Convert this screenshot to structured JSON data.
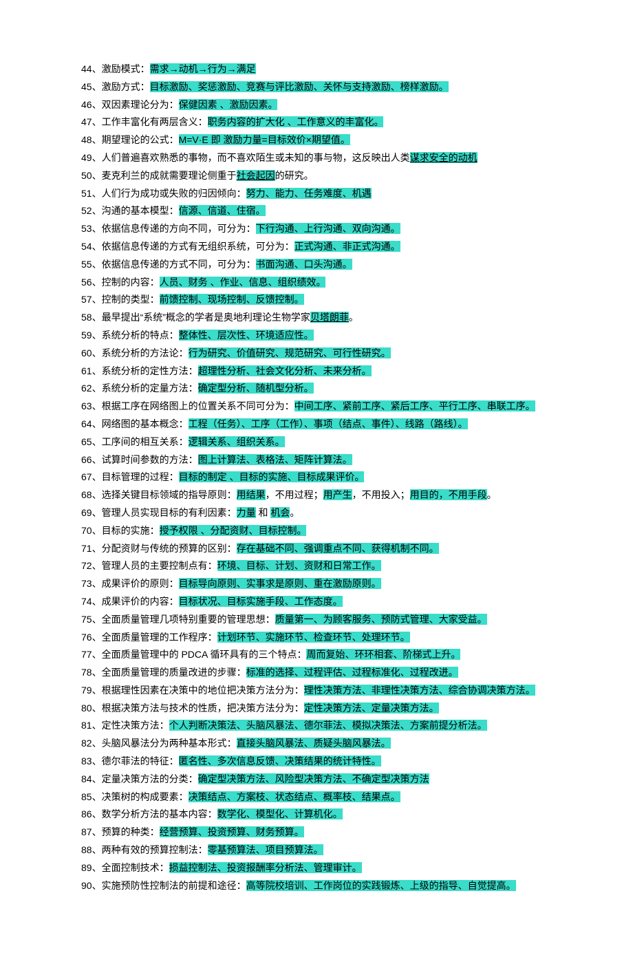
{
  "lines": [
    {
      "num": "44、",
      "parts": [
        {
          "t": "plain",
          "v": "激励模式："
        },
        {
          "t": "hl",
          "v": "需求→动机→行为→满足"
        }
      ]
    },
    {
      "num": "45、",
      "parts": [
        {
          "t": "plain",
          "v": "激励方式："
        },
        {
          "t": "hl",
          "v": "目标激励、奖惩激励、竞赛与评比激励、关怀与支持激励、榜样激励。"
        }
      ]
    },
    {
      "num": "46、",
      "parts": [
        {
          "t": "plain",
          "v": "双因素理论分为："
        },
        {
          "t": "hl",
          "v": "保健因素 、激励因素。"
        }
      ]
    },
    {
      "num": "47、",
      "parts": [
        {
          "t": "plain",
          "v": "工作丰富化有两层含义："
        },
        {
          "t": "hl",
          "v": "职务内容的扩大化 、工作意义的丰富化。"
        }
      ]
    },
    {
      "num": "48、",
      "parts": [
        {
          "t": "plain",
          "v": "期望理论的公式："
        },
        {
          "t": "hl",
          "v": "M=V·E 即 激励力量=目标效价×期望值。"
        }
      ]
    },
    {
      "num": "49、",
      "parts": [
        {
          "t": "plain",
          "v": "人们普遍喜欢熟悉的事物，而不喜欢陌生或未知的事与物，这反映出人类"
        },
        {
          "t": "hlul",
          "v": "谋求安全的动机"
        }
      ]
    },
    {
      "num": "50、",
      "parts": [
        {
          "t": "plain",
          "v": "麦克利兰的成就需要理论侧重于"
        },
        {
          "t": "hlul",
          "v": "社会起因"
        },
        {
          "t": "plain",
          "v": "的研究。"
        }
      ]
    },
    {
      "num": "51、",
      "parts": [
        {
          "t": "plain",
          "v": "人们行为成功或失败的归因倾向："
        },
        {
          "t": "hl",
          "v": "努力、能力、任务难度、机遇"
        }
      ]
    },
    {
      "num": "52、",
      "parts": [
        {
          "t": "plain",
          "v": "沟通的基本模型："
        },
        {
          "t": "hl",
          "v": "信源、信道、住宿。"
        }
      ]
    },
    {
      "num": "53、",
      "parts": [
        {
          "t": "plain",
          "v": "依据信息传递的方向不同，可分为："
        },
        {
          "t": "hl",
          "v": "下行沟通、上行沟通、双向沟通。"
        }
      ]
    },
    {
      "num": "54、",
      "parts": [
        {
          "t": "plain",
          "v": "依据信息传递的方式有无组织系统，可分为："
        },
        {
          "t": "hl",
          "v": "正式沟通、非正式沟通。"
        }
      ]
    },
    {
      "num": "55、",
      "parts": [
        {
          "t": "plain",
          "v": "依据信息传递的方式不同，可分为："
        },
        {
          "t": "hl",
          "v": "书面沟通、口头沟通。"
        }
      ]
    },
    {
      "num": "56、",
      "parts": [
        {
          "t": "plain",
          "v": "控制的内容："
        },
        {
          "t": "hl",
          "v": "人员、财务 、作业、信息、组织绩效。"
        }
      ]
    },
    {
      "num": "57、",
      "parts": [
        {
          "t": "plain",
          "v": "控制的类型："
        },
        {
          "t": "hl",
          "v": "前馈控制、现场控制、反馈控制。"
        }
      ]
    },
    {
      "num": "58、",
      "parts": [
        {
          "t": "plain",
          "v": "最早提出“系统”概念的学者是奥地利理论生物学家"
        },
        {
          "t": "hlul",
          "v": "贝塔朗菲"
        },
        {
          "t": "plain",
          "v": "。"
        }
      ]
    },
    {
      "num": "59、",
      "parts": [
        {
          "t": "plain",
          "v": "系统分析的特点："
        },
        {
          "t": "hl",
          "v": "整体性、层次性、环境适应性。"
        }
      ]
    },
    {
      "num": "60、",
      "parts": [
        {
          "t": "plain",
          "v": "系统分析的方法论："
        },
        {
          "t": "hl",
          "v": "行为研究、价值研究、规范研究、可行性研究。"
        }
      ]
    },
    {
      "num": "61、",
      "parts": [
        {
          "t": "plain",
          "v": "系统分析的定性方法："
        },
        {
          "t": "hl",
          "v": "超理性分析、社会文化分析、未来分析。"
        }
      ]
    },
    {
      "num": "62、",
      "parts": [
        {
          "t": "plain",
          "v": "系统分析的定量方法："
        },
        {
          "t": "hl",
          "v": "确定型分析、随机型分析。"
        }
      ]
    },
    {
      "num": "63、",
      "parts": [
        {
          "t": "plain",
          "v": "根据工序在网络图上的位置关系不同可分为："
        },
        {
          "t": "hl",
          "v": "中间工序、紧前工序、紧后工序、平行工序、串联工序。"
        }
      ]
    },
    {
      "num": "64、",
      "parts": [
        {
          "t": "plain",
          "v": "网络图的基本概念："
        },
        {
          "t": "hl",
          "v": "工程（任务）、工序（工作）、事项（结点、事件）、线路（路线）。"
        }
      ]
    },
    {
      "num": "65、",
      "parts": [
        {
          "t": "plain",
          "v": "工序间的相互关系："
        },
        {
          "t": "hl",
          "v": "逻辑关系、组织关系。"
        }
      ]
    },
    {
      "num": "66、",
      "parts": [
        {
          "t": "plain",
          "v": "试算时间参数的方法："
        },
        {
          "t": "hl",
          "v": "图上计算法、表格法、矩阵计算法。"
        }
      ]
    },
    {
      "num": "67、",
      "parts": [
        {
          "t": "plain",
          "v": "目标管理的过程："
        },
        {
          "t": "hl",
          "v": "目标的制定 、目标的实施、目标成果评价。"
        }
      ]
    },
    {
      "num": "68、",
      "parts": [
        {
          "t": "plain",
          "v": "选择关键目标领域的指导原则："
        },
        {
          "t": "hl",
          "v": "用结果"
        },
        {
          "t": "plain",
          "v": "，不用过程；"
        },
        {
          "t": "hl",
          "v": "用产生"
        },
        {
          "t": "plain",
          "v": "，不用投入；"
        },
        {
          "t": "hl",
          "v": "用目的，不用手段"
        },
        {
          "t": "plain",
          "v": "。"
        }
      ]
    },
    {
      "num": "69、",
      "parts": [
        {
          "t": "plain",
          "v": "管理人员实现目标的有利因素："
        },
        {
          "t": "hl",
          "v": "力量"
        },
        {
          "t": "plain",
          "v": " 和 "
        },
        {
          "t": "hl",
          "v": "机会"
        },
        {
          "t": "plain",
          "v": "。"
        }
      ]
    },
    {
      "num": "70、",
      "parts": [
        {
          "t": "plain",
          "v": "目标的实施："
        },
        {
          "t": "hl",
          "v": "授予权限 、分配资财、目标控制。"
        }
      ]
    },
    {
      "num": "71、",
      "parts": [
        {
          "t": "plain",
          "v": "分配资财与传统的预算的区别："
        },
        {
          "t": "hl",
          "v": "存在基础不同、强调重点不同、获得机制不同。"
        }
      ]
    },
    {
      "num": "72、",
      "parts": [
        {
          "t": "plain",
          "v": "管理人员的主要控制点有："
        },
        {
          "t": "hl",
          "v": "环境、目标、计划、资财和日常工作。"
        }
      ]
    },
    {
      "num": "73、",
      "parts": [
        {
          "t": "plain",
          "v": "成果评价的原则："
        },
        {
          "t": "hl",
          "v": "目标导向原则、实事求是原则、重在激励原则。"
        }
      ]
    },
    {
      "num": "74、",
      "parts": [
        {
          "t": "plain",
          "v": "成果评价的内容："
        },
        {
          "t": "hl",
          "v": "目标状况、目标实施手段、工作态度。"
        }
      ]
    },
    {
      "num": "75、",
      "parts": [
        {
          "t": "plain",
          "v": "全面质量管理几项特别重要的管理思想："
        },
        {
          "t": "hl",
          "v": "质量第一、为顾客服务、预防式管理、大家受益。"
        }
      ]
    },
    {
      "num": "76、",
      "parts": [
        {
          "t": "plain",
          "v": "全面质量管理的工作程序："
        },
        {
          "t": "hl",
          "v": "计划环节、实施环节、检查环节、处理环节。"
        }
      ]
    },
    {
      "num": "77、",
      "parts": [
        {
          "t": "plain",
          "v": "全面质量管理中的 PDCA 循环具有的三个特点："
        },
        {
          "t": "hl",
          "v": "周而复始、环环相套、阶梯式上升。"
        }
      ]
    },
    {
      "num": "78、",
      "parts": [
        {
          "t": "plain",
          "v": "全面质量管理的质量改进的步骤："
        },
        {
          "t": "hl",
          "v": "标准的选择、过程评估、过程标准化、过程改进。"
        }
      ]
    },
    {
      "num": "79、",
      "parts": [
        {
          "t": "plain",
          "v": "根据理性因素在决策中的地位把决策方法分为："
        },
        {
          "t": "hl",
          "v": "理性决策方法、非理性决策方法、综合协调决策方法。"
        }
      ]
    },
    {
      "num": "80、",
      "parts": [
        {
          "t": "plain",
          "v": "根据决策方法与技术的性质，把决策方法分为："
        },
        {
          "t": "hl",
          "v": "定性决策方法、定量决策方法。"
        }
      ]
    },
    {
      "num": "81、",
      "parts": [
        {
          "t": "plain",
          "v": "定性决策方法："
        },
        {
          "t": "hl",
          "v": "个人判断决策法、头脑风暴法、德尔菲法、模拟决策法、方案前提分析法。"
        }
      ]
    },
    {
      "num": "82、",
      "parts": [
        {
          "t": "plain",
          "v": "头脑风暴法分为两种基本形式："
        },
        {
          "t": "hl",
          "v": "直接头脑风暴法、质疑头脑风暴法。"
        }
      ]
    },
    {
      "num": "83、",
      "parts": [
        {
          "t": "plain",
          "v": "德尔菲法的特征："
        },
        {
          "t": "hl",
          "v": "匿名性、多次信息反馈、决策结果的统计特性。"
        }
      ]
    },
    {
      "num": "84、",
      "parts": [
        {
          "t": "plain",
          "v": "定量决策方法的分类："
        },
        {
          "t": "hl",
          "v": "确定型决策方法、风险型决策方法、不确定型决策方法"
        }
      ]
    },
    {
      "num": "85、",
      "parts": [
        {
          "t": "plain",
          "v": "决策树的构成要素："
        },
        {
          "t": "hl",
          "v": "决策结点、方案枝、状态结点、概率枝、结果点。"
        }
      ]
    },
    {
      "num": "86、",
      "parts": [
        {
          "t": "plain",
          "v": "数学分析方法的基本内容："
        },
        {
          "t": "hl",
          "v": "数学化、模型化、计算机化。"
        }
      ]
    },
    {
      "num": "87、",
      "parts": [
        {
          "t": "plain",
          "v": "预算的种类："
        },
        {
          "t": "hl",
          "v": "经营预算、投资预算、财务预算。"
        }
      ]
    },
    {
      "num": "88、",
      "parts": [
        {
          "t": "plain",
          "v": "两种有效的预算控制法："
        },
        {
          "t": "hl",
          "v": "零基预算法、项目预算法。"
        }
      ]
    },
    {
      "num": "89、",
      "parts": [
        {
          "t": "plain",
          "v": "全面控制技术："
        },
        {
          "t": "hl",
          "v": "损益控制法、投资报酬率分析法、管理审计。"
        }
      ]
    },
    {
      "num": "90、",
      "parts": [
        {
          "t": "plain",
          "v": "实施预防性控制法的前提和途径："
        },
        {
          "t": "hl",
          "v": "高等院校培训、工作岗位的实践锻炼、上级的指导、自觉提高。"
        }
      ]
    }
  ]
}
